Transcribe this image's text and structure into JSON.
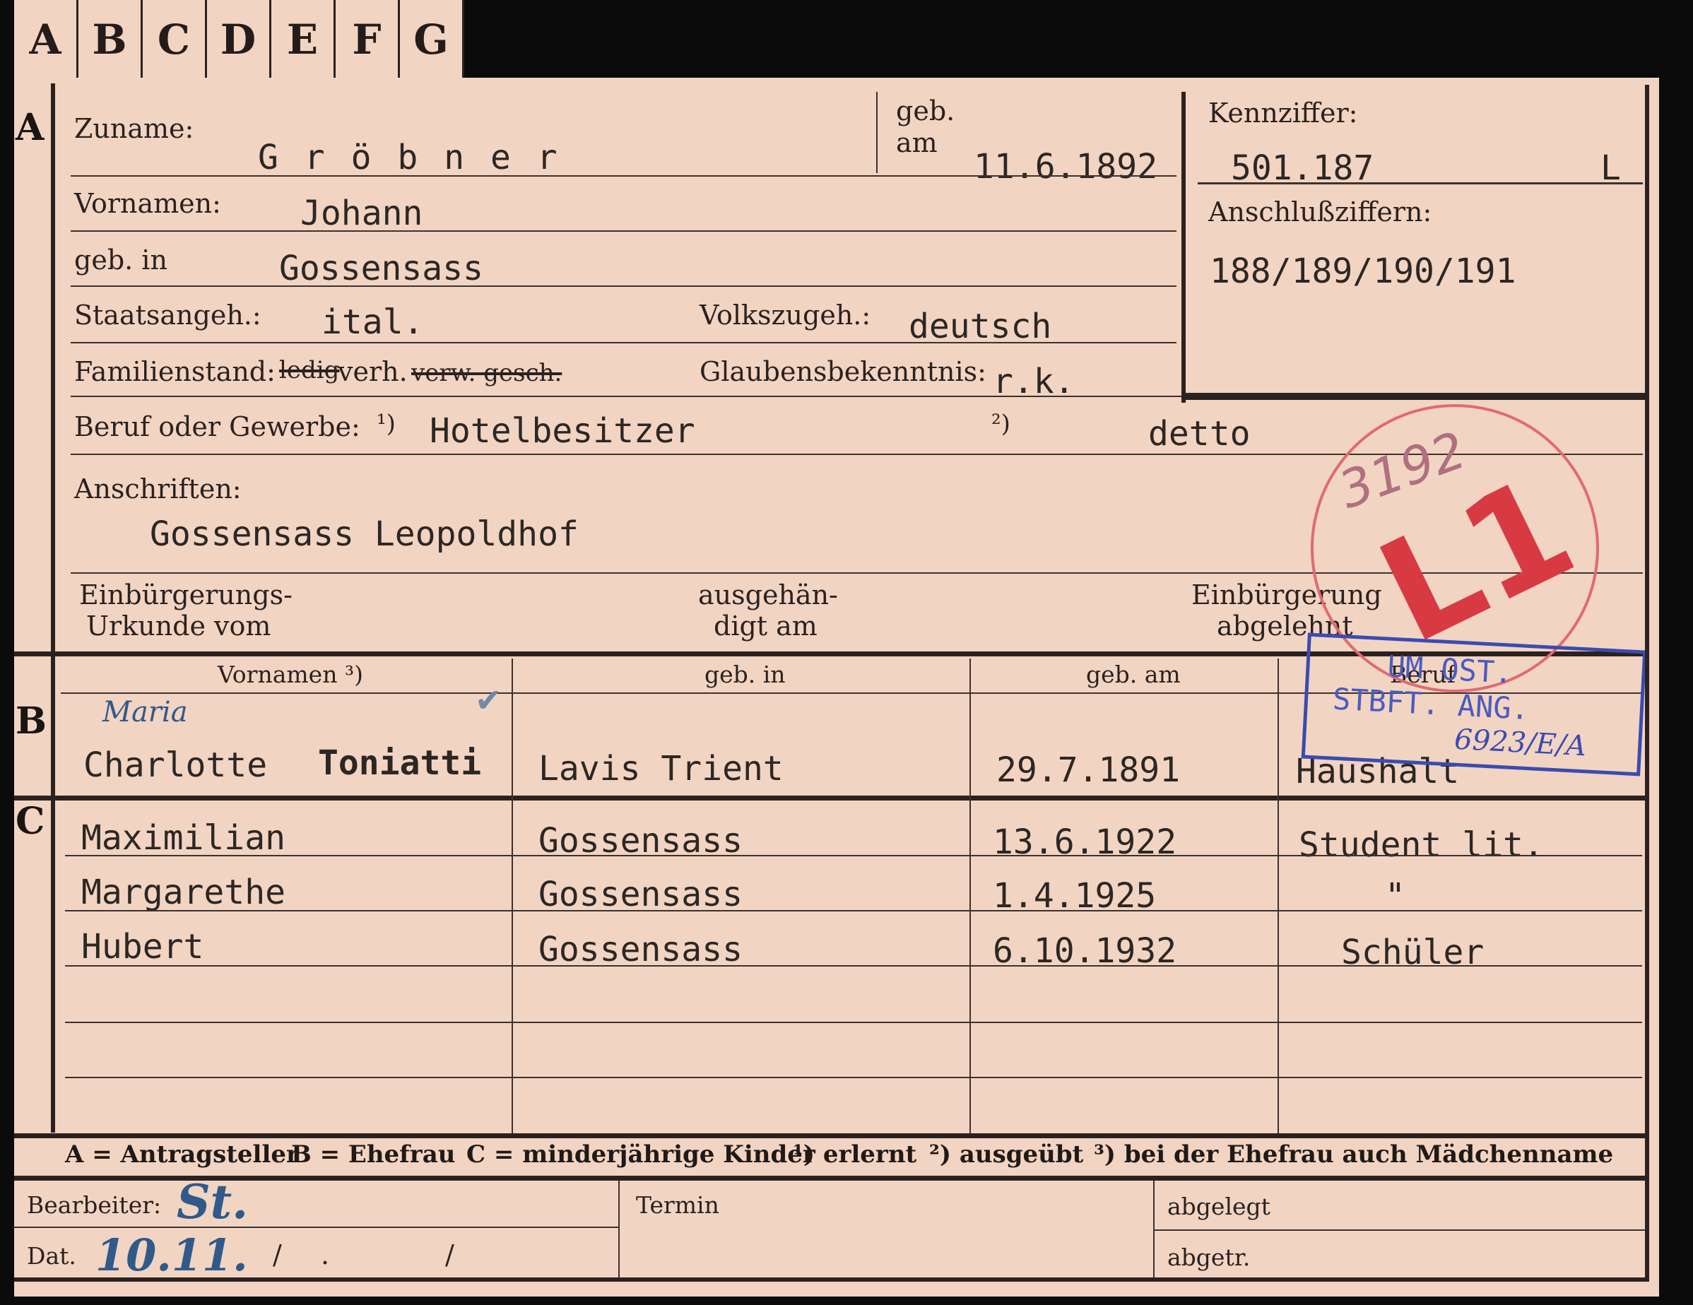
{
  "tabs": [
    "A",
    "B",
    "C",
    "D",
    "E",
    "F",
    "G"
  ],
  "section_letters": {
    "a": "A",
    "b": "B",
    "c": "C"
  },
  "applicant": {
    "surname_label": "Zuname:",
    "surname": "G r ö b n e r",
    "born_on_label_1": "geb.",
    "born_on_label_2": "am",
    "born_on": "11.6.1892",
    "file_no_label": "Kennziffer:",
    "file_no": "501.187",
    "file_no_suffix": "L",
    "related_no_label": "Anschlußziffern:",
    "related_no": "188/189/190/191",
    "first_names_label": "Vornamen:",
    "first_names": "Johann",
    "birthplace_label": "geb. in",
    "birthplace": "Gossensass",
    "citizenship_label": "Staatsangeh.:",
    "citizenship": "ital.",
    "ethnicity_label": "Volkszugeh.:",
    "ethnicity": "deutsch",
    "marital_label": "Familienstand:",
    "marital_struck_1": "ledig",
    "marital_value": "verh.",
    "marital_struck_2": "verw. gesch.",
    "religion_label": "Glaubensbekenntnis:",
    "religion": "r.k.",
    "occupation_label": "Beruf oder Gewerbe:",
    "occ_marker_1": "¹)",
    "occupation_learned": "Hotelbesitzer",
    "occ_marker_2": "²)",
    "occupation_practiced": "detto",
    "address_label": "Anschriften:",
    "address": "Gossensass Leopoldhof",
    "naturalization_label_1": "Einbürgerungs-",
    "naturalization_label_2": "Urkunde vom",
    "handed_label_1": "ausgehän-",
    "handed_label_2": "digt am",
    "refused_label_1": "Einbürgerung",
    "refused_label_2": "abgelehnt"
  },
  "spouse": {
    "col_first_names": "Vornamen ³)",
    "col_birthplace": "geb. in",
    "col_born_on": "geb. am",
    "col_occupation": "Beruf",
    "handwritten_name": "Maria",
    "first_name": "Charlotte",
    "maiden_name": "Toniatti",
    "birthplace": "Lavis Trient",
    "born_on": "29.7.1891",
    "occupation": "Haushalt"
  },
  "children": [
    {
      "name": "Maximilian",
      "birthplace": "Gossensass",
      "born_on": "13.6.1922",
      "occupation": "Student lit."
    },
    {
      "name": "Margarethe",
      "birthplace": "Gossensass",
      "born_on": "1.4.1925",
      "occupation": "\""
    },
    {
      "name": "Hubert",
      "birthplace": "Gossensass",
      "born_on": "6.10.1932",
      "occupation": "Schüler"
    }
  ],
  "legend": {
    "a": "A = Antragsteller",
    "b": "B = Ehefrau",
    "c": "C = minderjährige Kinder",
    "n1": "¹) erlernt",
    "n2": "²) ausgeübt",
    "n3": "³) bei der Ehefrau auch Mädchenname"
  },
  "footer": {
    "clerk_label": "Bearbeiter:",
    "clerk_initials": "St.",
    "date_label": "Dat.",
    "date_hand": "10.11.",
    "slash_1": "/",
    "dot": ".",
    "slash_2": "/",
    "deadline_label": "Termin",
    "filed_label": "abgelegt",
    "separated_label": "abgetr."
  },
  "stamps": {
    "red_number": "3192",
    "red_code": "L1",
    "blue_line_1": "UM OST.",
    "blue_line_2": "STBFT. ANG.",
    "blue_ref": "6923/E/A"
  },
  "colors": {
    "card": "#f2d4c2",
    "ink": "#2b2725",
    "red_stamp": "#d83a44",
    "blue_stamp": "#3a4cb0"
  }
}
